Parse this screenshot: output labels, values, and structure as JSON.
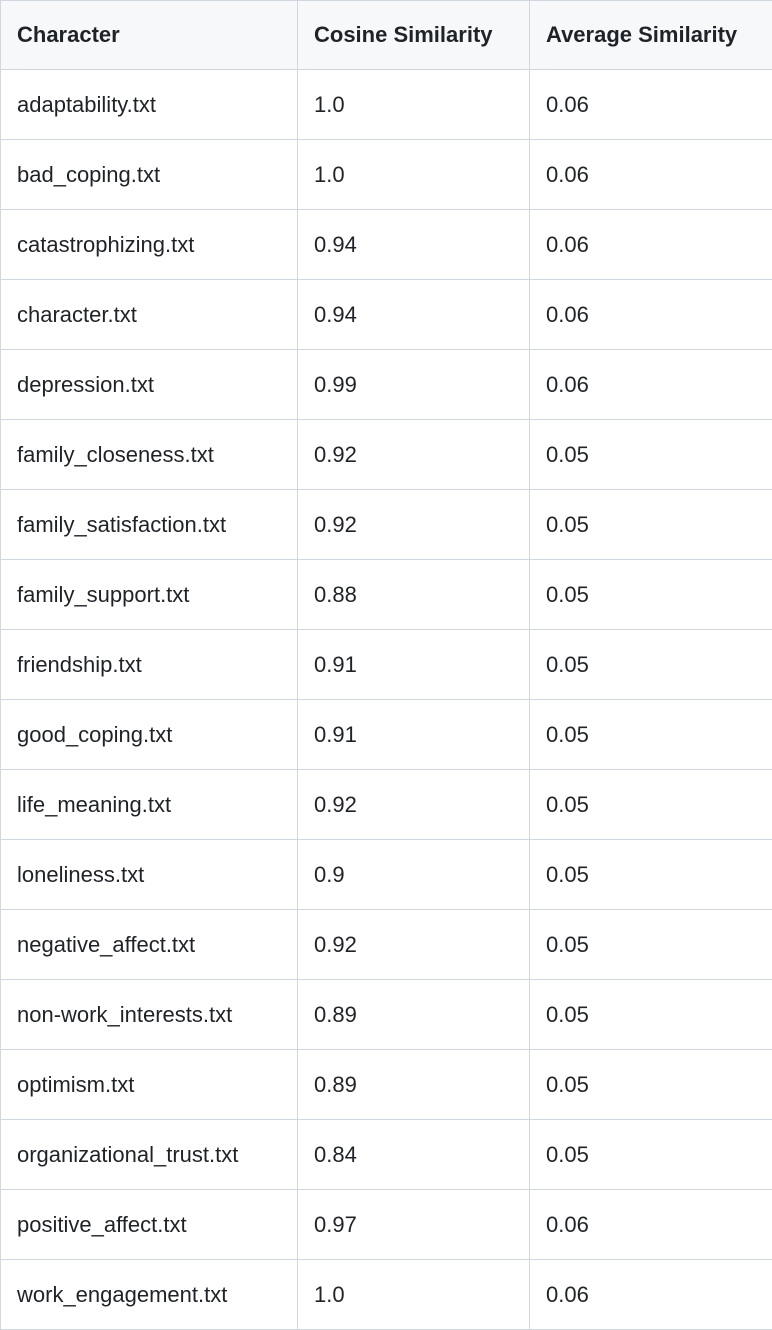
{
  "table": {
    "headers": [
      "Character",
      "Cosine Similarity",
      "Average Similarity"
    ],
    "rows": [
      [
        "adaptability.txt",
        "1.0",
        "0.06"
      ],
      [
        "bad_coping.txt",
        "1.0",
        "0.06"
      ],
      [
        "catastrophizing.txt",
        "0.94",
        "0.06"
      ],
      [
        "character.txt",
        "0.94",
        "0.06"
      ],
      [
        "depression.txt",
        "0.99",
        "0.06"
      ],
      [
        "family_closeness.txt",
        "0.92",
        "0.05"
      ],
      [
        "family_satisfaction.txt",
        "0.92",
        "0.05"
      ],
      [
        "family_support.txt",
        "0.88",
        "0.05"
      ],
      [
        "friendship.txt",
        "0.91",
        "0.05"
      ],
      [
        "good_coping.txt",
        "0.91",
        "0.05"
      ],
      [
        "life_meaning.txt",
        "0.92",
        "0.05"
      ],
      [
        "loneliness.txt",
        "0.9",
        "0.05"
      ],
      [
        "negative_affect.txt",
        "0.92",
        "0.05"
      ],
      [
        "non-work_interests.txt",
        "0.89",
        "0.05"
      ],
      [
        "optimism.txt",
        "0.89",
        "0.05"
      ],
      [
        "organizational_trust.txt",
        "0.84",
        "0.05"
      ],
      [
        "positive_affect.txt",
        "0.97",
        "0.06"
      ],
      [
        "work_engagement.txt",
        "1.0",
        "0.06"
      ]
    ]
  }
}
